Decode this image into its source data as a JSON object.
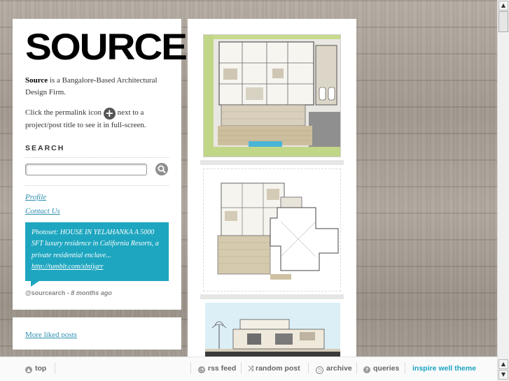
{
  "sidebar": {
    "logo": "SOURCE",
    "desc_bold": "Source",
    "desc_rest": " is a Bangalore-Based Architectural Design Firm.",
    "permalink_before": "Click the permalink icon ",
    "permalink_after": " next to a project/post title to see it in full-screen.",
    "search_heading": "SEARCH",
    "search_placeholder": "",
    "links": [
      "Profile",
      "Contact Us"
    ],
    "tweet": {
      "text": "Photoset: HOUSE IN YELAHANKA A 5000 SFT luxury residence in California Resorts, a private residential enclave...",
      "url": "http://tumblr.com/xlnijgrr",
      "handle": "@sourcearch",
      "time": " - 8 months ago"
    }
  },
  "liked": {
    "label": "More liked posts"
  },
  "bottom_bar": {
    "top": "top",
    "rss": "rss feed",
    "random": "random post",
    "archive": "archive",
    "queries": "queries",
    "theme": "inspire well theme"
  },
  "colors": {
    "accent": "#1ea6c0",
    "link": "#2a8fb0"
  },
  "icons": {
    "permalink": "plus-circle-icon",
    "search": "magnifier-icon",
    "top": "arrow-up-icon",
    "rss": "rss-icon",
    "random": "shuffle-icon",
    "archive": "clock-icon",
    "queries": "question-icon"
  }
}
